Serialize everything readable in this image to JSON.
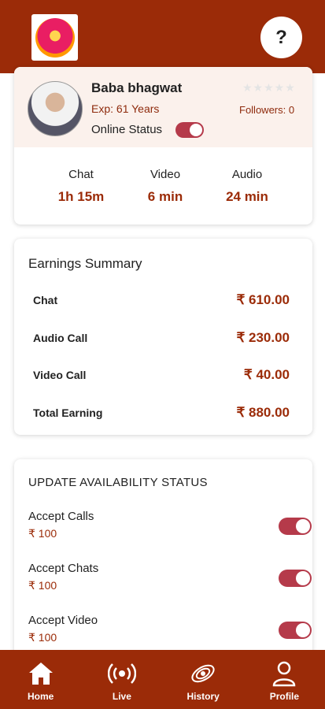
{
  "header": {
    "help_label": "?"
  },
  "profile": {
    "name": "Baba bhagwat",
    "experience": "Exp: 61 Years",
    "rating_stars": "★★★★★",
    "followers": "Followers: 0",
    "online_status_label": "Online Status",
    "online_status_on": true
  },
  "usage": [
    {
      "label": "Chat",
      "value": "1h 15m"
    },
    {
      "label": "Video",
      "value": "6 min"
    },
    {
      "label": "Audio",
      "value": "24 min"
    }
  ],
  "earnings": {
    "title": "Earnings Summary",
    "rows": [
      {
        "label": "Chat",
        "value": "₹ 610.00"
      },
      {
        "label": "Audio Call",
        "value": "₹ 230.00"
      },
      {
        "label": "Video Call",
        "value": "₹ 40.00"
      },
      {
        "label": "Total Earning",
        "value": "₹ 880.00"
      }
    ]
  },
  "availability": {
    "title": "UPDATE AVAILABILITY STATUS",
    "items": [
      {
        "label": "Accept Calls",
        "price": "₹ 100",
        "on": true
      },
      {
        "label": "Accept Chats",
        "price": "₹ 100",
        "on": true
      },
      {
        "label": "Accept Video",
        "price": "₹ 100",
        "on": true
      }
    ]
  },
  "nav": [
    {
      "label": "Home",
      "icon": "home-icon"
    },
    {
      "label": "Live",
      "icon": "live-icon"
    },
    {
      "label": "History",
      "icon": "history-icon"
    },
    {
      "label": "Profile",
      "icon": "profile-icon"
    }
  ],
  "colors": {
    "primary": "#9b2b08",
    "toggle": "#b53a4a",
    "profile_bg": "#fbf1ec"
  }
}
